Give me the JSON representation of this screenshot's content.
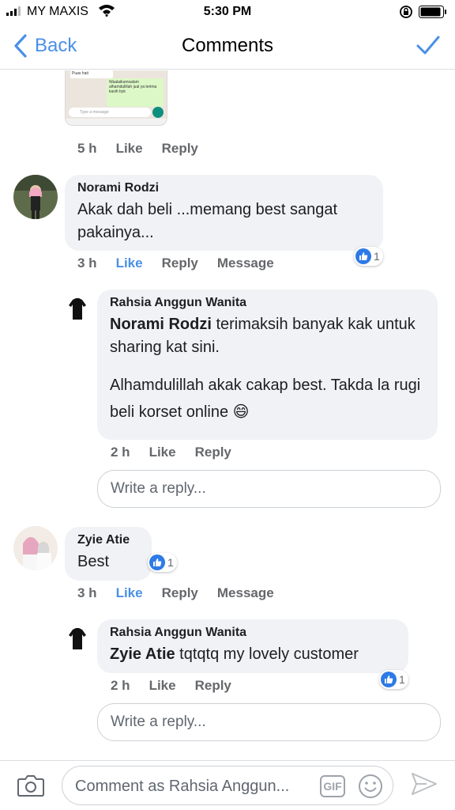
{
  "status_bar": {
    "carrier": "MY MAXIS",
    "time": "5:30 PM"
  },
  "nav": {
    "back_label": "Back",
    "title": "Comments"
  },
  "attachment": {
    "bubble1": "Puas hati",
    "bubble2": "Waalaikumsalam alhamdulillah jual ya terima kasih byk",
    "input_placeholder": "Type a message"
  },
  "comments": [
    {
      "time": "5 h",
      "like": "Like",
      "reply": "Reply"
    },
    {
      "author": "Norami Rodzi",
      "text": "Akak dah beli ...memang best sangat pakainya...",
      "time": "3 h",
      "like": "Like",
      "reply": "Reply",
      "message": "Message",
      "reactions": "1",
      "replies": [
        {
          "author": "Rahsia Anggun Wanita",
          "mention": "Norami Rodzi",
          "text": " terimaksih banyak kak untuk sharing kat sini.",
          "text2": "Alhamdulillah akak cakap best. Takda la rugi beli korset online 😄",
          "time": "2 h",
          "like": "Like",
          "reply": "Reply"
        }
      ],
      "reply_placeholder": "Write a reply..."
    },
    {
      "author": "Zyie Atie",
      "text": "Best",
      "time": "3 h",
      "like": "Like",
      "reply": "Reply",
      "message": "Message",
      "reactions": "1",
      "replies": [
        {
          "author": "Rahsia Anggun Wanita",
          "mention": "Zyie Atie",
          "text": " tqtqtq my lovely customer",
          "time": "2 h",
          "like": "Like",
          "reply": "Reply",
          "reactions": "1"
        }
      ],
      "reply_placeholder": "Write a reply..."
    }
  ],
  "composer": {
    "placeholder": "Comment as Rahsia Anggun...",
    "gif_label": "GIF"
  },
  "colors": {
    "accent": "#4a8fe7",
    "like_blue": "#2e7ae6",
    "bubble_bg": "#f0f2f5"
  }
}
